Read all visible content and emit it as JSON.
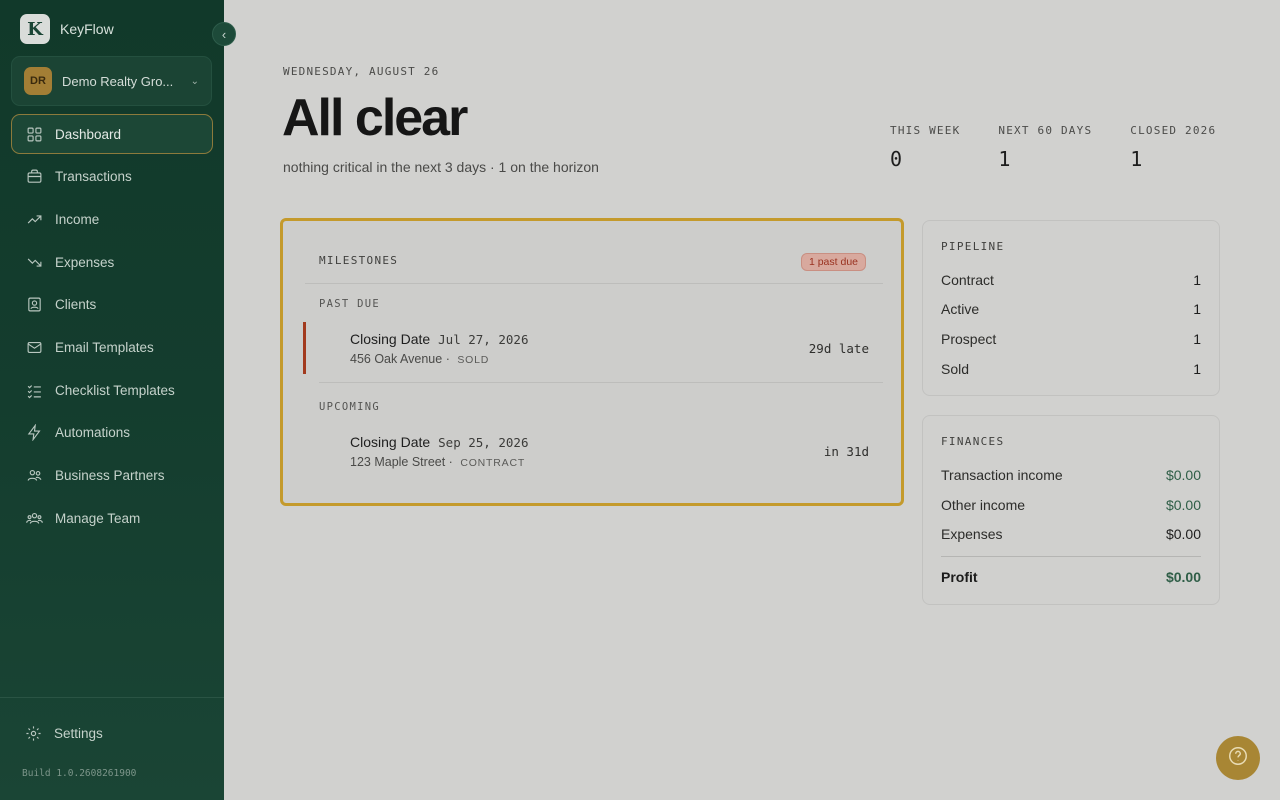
{
  "app": {
    "name": "KeyFlow",
    "logo_letter": "K"
  },
  "org": {
    "initials": "DR",
    "name": "Demo Realty Gro..."
  },
  "nav": [
    {
      "label": "Dashboard",
      "icon": "grid-icon",
      "active": true
    },
    {
      "label": "Transactions",
      "icon": "briefcase-icon"
    },
    {
      "label": "Income",
      "icon": "trend-up-icon"
    },
    {
      "label": "Expenses",
      "icon": "trend-down-icon"
    },
    {
      "label": "Clients",
      "icon": "contacts-icon"
    },
    {
      "label": "Email Templates",
      "icon": "mail-icon"
    },
    {
      "label": "Checklist Templates",
      "icon": "checklist-icon"
    },
    {
      "label": "Automations",
      "icon": "bolt-icon"
    },
    {
      "label": "Business Partners",
      "icon": "partners-icon"
    },
    {
      "label": "Manage Team",
      "icon": "team-icon"
    }
  ],
  "settings_label": "Settings",
  "build": "Build 1.0.2608261900",
  "header": {
    "date": "WEDNESDAY, AUGUST 26",
    "title": "All clear",
    "subtitle": "nothing critical in the next 3 days · 1 on the horizon"
  },
  "stats": [
    {
      "label": "THIS WEEK",
      "value": "0"
    },
    {
      "label": "NEXT 60 DAYS",
      "value": "1"
    },
    {
      "label": "CLOSED 2026",
      "value": "1"
    }
  ],
  "milestones": {
    "title": "MILESTONES",
    "badge": "1 past due",
    "past_due_label": "PAST DUE",
    "upcoming_label": "UPCOMING",
    "past": {
      "title": "Closing Date",
      "date": "Jul 27, 2026",
      "address": "456 Oak Avenue",
      "status": "SOLD",
      "right": "29d late"
    },
    "upcoming": {
      "title": "Closing Date",
      "date": "Sep 25, 2026",
      "address": "123 Maple Street",
      "status": "CONTRACT",
      "right": "in 31d"
    }
  },
  "pipeline": {
    "title": "PIPELINE",
    "rows": [
      {
        "label": "Contract",
        "value": "1"
      },
      {
        "label": "Active",
        "value": "1"
      },
      {
        "label": "Prospect",
        "value": "1"
      },
      {
        "label": "Sold",
        "value": "1"
      }
    ]
  },
  "finances": {
    "title": "FINANCES",
    "rows": [
      {
        "label": "Transaction income",
        "value": "$0.00"
      },
      {
        "label": "Other income",
        "value": "$0.00"
      },
      {
        "label": "Expenses",
        "value": "$0.00"
      }
    ],
    "profit": {
      "label": "Profit",
      "value": "$0.00"
    }
  },
  "colors": {
    "sidebar": "#11392a",
    "accent": "#c49a2c",
    "danger": "#a23a1e",
    "income": "#2f5e47"
  }
}
